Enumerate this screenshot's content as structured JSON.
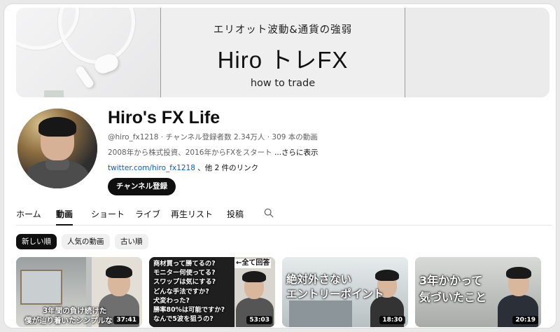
{
  "banner": {
    "subtitle": "エリオット波動&通貨の強弱",
    "title": "Hiro トレFX",
    "tagline": "how to trade"
  },
  "channel": {
    "name": "Hiro's FX Life",
    "handle": "@hiro_fx1218",
    "meta_rest": " · チャンネル登録者数 2.34万人 · 309 本の動画",
    "description": "2008年から株式投資、2016年からFXをスタート",
    "more": " ...さらに表示",
    "link": "twitter.com/hiro_fx1218",
    "link_rest": " 、他 2 件のリンク",
    "subscribe_label": "チャンネル登録"
  },
  "tabs": [
    "ホーム",
    "動画",
    "ショート",
    "ライブ",
    "再生リスト",
    "投稿"
  ],
  "active_tab": "動画",
  "chips": [
    "新しい順",
    "人気の動画",
    "古い順"
  ],
  "videos": [
    {
      "caption_lines": [
        "3年間の負け続けた",
        "僕が辿り着いたシンプルな"
      ],
      "duration": "37:41"
    },
    {
      "caption_lines": [
        "商材買って勝てるの?",
        "モニター何使ってる?",
        "スワップは気にする?",
        "どんな手法ですか?",
        "犬変わった?",
        "勝率80%は可能ですか?",
        "なんで5波を狙うの?"
      ],
      "arrow_label": "←全て回答",
      "duration": "53:03"
    },
    {
      "caption_lines": [
        "絶対外さない",
        "エントリーポイント"
      ],
      "duration": "18:30"
    },
    {
      "caption_lines": [
        "3年かかって",
        "気づいたこと"
      ],
      "duration": "20:19"
    }
  ],
  "icons": {
    "search": "search-icon"
  },
  "colors": {
    "link": "#065fd4",
    "chip_active": "#0f0f0f",
    "subscribe": "#0f0f0f"
  }
}
